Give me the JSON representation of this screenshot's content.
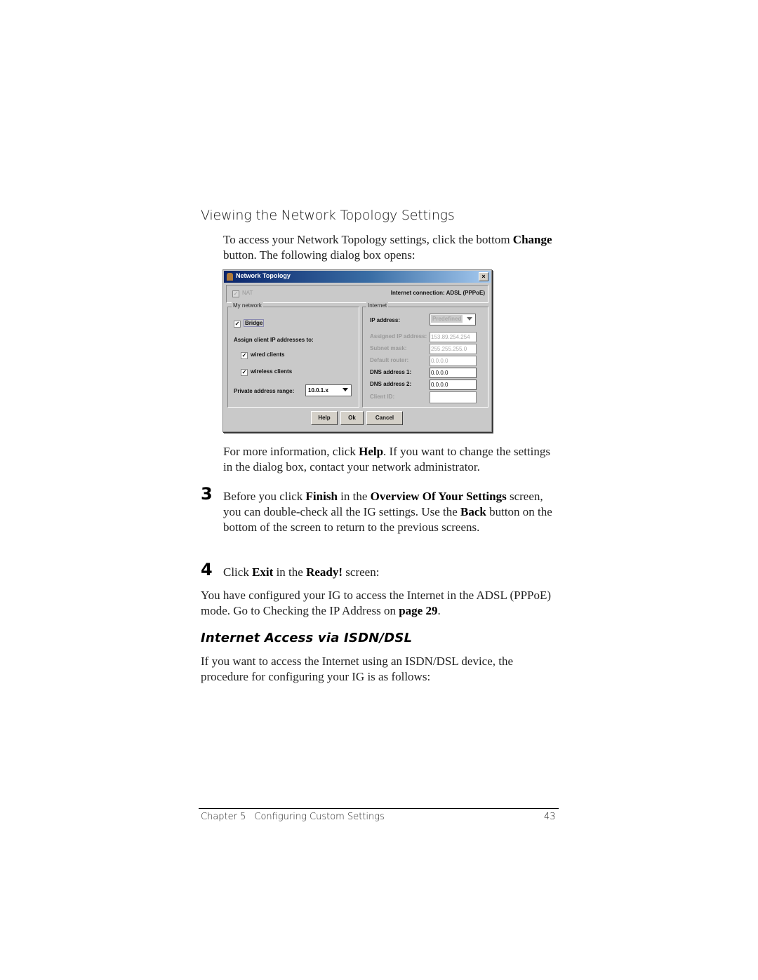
{
  "section_heading": "Viewing the Network Topology Settings",
  "intro": {
    "text1": "To access your Network Topology settings, click the bottom ",
    "bold1": "Change",
    "text2": " button. The following dialog box opens:"
  },
  "dialog": {
    "title": "Network Topology",
    "close_glyph": "×",
    "nat_label": "NAT",
    "nat_checked": true,
    "internet_connection": "Internet connection: ADSL (PPPoE)",
    "my_network": {
      "legend": "My network",
      "bridge_label": "Bridge",
      "bridge_checked": true,
      "assign_label": "Assign client IP addresses to:",
      "wired_label": "wired clients",
      "wired_checked": true,
      "wireless_label": "wireless clients",
      "wireless_checked": true,
      "range_label": "Private address range:",
      "range_value": "10.0.1.x"
    },
    "internet": {
      "legend": "Internet",
      "ip_address_label": "IP address:",
      "ip_address_mode": "Predefined",
      "assigned_ip_label": "Assigned IP address:",
      "assigned_ip_value": "153.89.254.254",
      "subnet_label": "Subnet mask:",
      "subnet_value": "255.255.255.0",
      "router_label": "Default router:",
      "router_value": "0.0.0.0",
      "dns1_label": "DNS address 1:",
      "dns1_value": "0.0.0.0",
      "dns2_label": "DNS address 2:",
      "dns2_value": "0.0.0.0",
      "client_id_label": "Client ID:",
      "client_id_value": ""
    },
    "buttons": {
      "help": "Help",
      "ok": "Ok",
      "cancel": "Cancel"
    },
    "check_glyph": "✓"
  },
  "more_info": {
    "text1": "For more information, click ",
    "bold1": "Help",
    "text2": ". If you want to change the settings in the dialog box, contact your network administrator."
  },
  "step3": {
    "number": "3",
    "text1": "Before you click ",
    "bold1": "Finish",
    "text2": " in the ",
    "bold2": "Overview Of Your Settings",
    "text3": " screen, you can double-check all the IG settings. Use the ",
    "bold3": "Back",
    "text4": " button on the bottom of the screen to return to the previous screens."
  },
  "step4": {
    "number": "4",
    "text1": "Click ",
    "bold1": "Exit",
    "text2": " in the ",
    "bold2": "Ready!",
    "text3": " screen:"
  },
  "configured": {
    "text1": "You have configured your IG to access the Internet in the ADSL (PPPoE) mode. Go to Checking the IP Address on ",
    "bold1": "page 29",
    "text2": "."
  },
  "isdn_heading": "Internet Access via ISDN/DSL",
  "isdn_para": "If you want to access the Internet using an ISDN/DSL device, the procedure for configuring your IG is as follows:",
  "footer": {
    "chapter": "Chapter 5",
    "chapter_title": "Configuring Custom Settings",
    "page_number": "43"
  }
}
